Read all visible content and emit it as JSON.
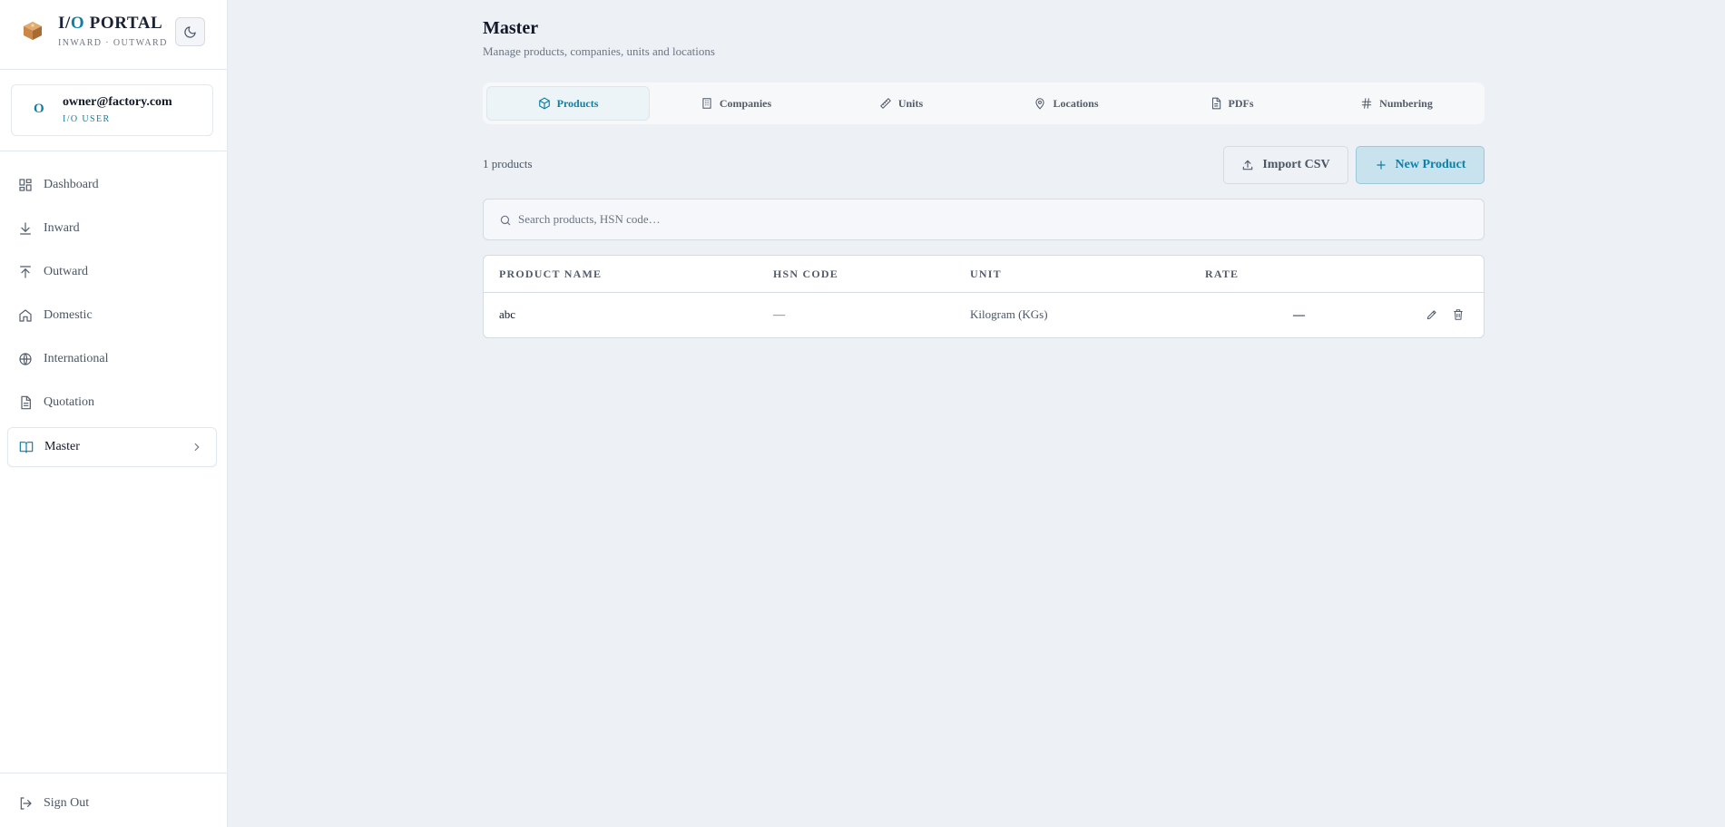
{
  "brand": {
    "title_prefix": "I/",
    "title_o": "O",
    "title_suffix": " PORTAL",
    "subtitle": "INWARD · OUTWARD",
    "logo_icon": "package-box-icon",
    "theme_icon": "moon-icon"
  },
  "user": {
    "avatar_letter": "O",
    "email": "owner@factory.com",
    "role": "I/O USER"
  },
  "sidebar": {
    "items": [
      {
        "label": "Dashboard",
        "icon": "grid-icon"
      },
      {
        "label": "Inward",
        "icon": "arrow-down-icon"
      },
      {
        "label": "Outward",
        "icon": "arrow-up-icon"
      },
      {
        "label": "Domestic",
        "icon": "home-icon"
      },
      {
        "label": "International",
        "icon": "globe-icon"
      },
      {
        "label": "Quotation",
        "icon": "document-icon"
      },
      {
        "label": "Master",
        "icon": "book-open-icon",
        "active": true
      }
    ],
    "sign_out": "Sign Out"
  },
  "page": {
    "title": "Master",
    "subtitle": "Manage products, companies, units and locations"
  },
  "tabs": [
    {
      "label": "Products",
      "icon": "cube-icon",
      "active": true
    },
    {
      "label": "Companies",
      "icon": "building-icon"
    },
    {
      "label": "Units",
      "icon": "ruler-icon"
    },
    {
      "label": "Locations",
      "icon": "map-pin-icon"
    },
    {
      "label": "PDFs",
      "icon": "file-icon"
    },
    {
      "label": "Numbering",
      "icon": "hash-icon"
    }
  ],
  "toolbar": {
    "count": "1 products",
    "import_label": "Import CSV",
    "new_label": "New Product"
  },
  "search": {
    "placeholder": "Search products, HSN code…",
    "value": ""
  },
  "table": {
    "columns": [
      "PRODUCT NAME",
      "HSN CODE",
      "UNIT",
      "RATE"
    ],
    "rows": [
      {
        "name": "abc",
        "hsn": "—",
        "unit": "Kilogram (KGs)",
        "rate": "—"
      }
    ]
  },
  "colors": {
    "accent": "#0e7fa5",
    "background": "#edf1f5",
    "sidebar": "#ffffff"
  }
}
